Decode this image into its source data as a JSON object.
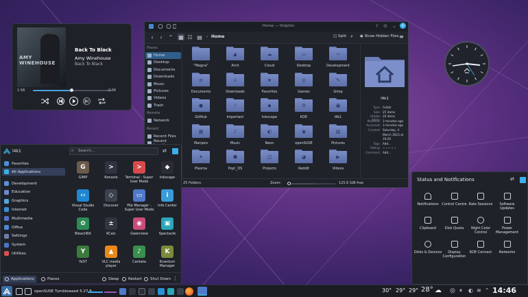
{
  "player": {
    "cover_text": "AMY\nWINEHOUSE",
    "title": "Back To Black",
    "artist": "Amy Winehouse",
    "album": "Back To Black",
    "elapsed": "1:58",
    "remaining": "-2:06",
    "progress_fraction": 0.49
  },
  "dolphin": {
    "title": "Home — Dolphin",
    "breadcrumb": "Home",
    "split_label": "Split",
    "hidden_files_label": "Show Hidden Files",
    "places_header": "Places",
    "places": [
      "Home",
      "Desktop",
      "Documents",
      "Downloads",
      "Music",
      "Pictures",
      "Videos",
      "Trash"
    ],
    "remote_header": "Remote",
    "remote": [
      "Network"
    ],
    "recent_header": "Recent",
    "recent": [
      "Recent Files",
      "Recent Locations"
    ],
    "folders": [
      {
        "name": "\"Magna\"",
        "emblem": ""
      },
      {
        "name": "Arch",
        "emblem": "▲"
      },
      {
        "name": "Cloud",
        "emblem": "☁"
      },
      {
        "name": "Desktop",
        "emblem": "▭"
      },
      {
        "name": "Development",
        "emblem": "‹›"
      },
      {
        "name": "Documents",
        "emblem": "≡"
      },
      {
        "name": "Downloads",
        "emblem": "↓"
      },
      {
        "name": "Favorites",
        "emblem": "★"
      },
      {
        "name": "Games",
        "emblem": "◎"
      },
      {
        "name": "Gimp",
        "emblem": "✎"
      },
      {
        "name": "GitHub",
        "emblem": "●"
      },
      {
        "name": "Important",
        "emblem": "!"
      },
      {
        "name": "Inkscape",
        "emblem": "◆"
      },
      {
        "name": "KDE",
        "emblem": "⚙"
      },
      {
        "name": "l4k1",
        "emblem": "▣"
      },
      {
        "name": "Manjaro",
        "emblem": "▦"
      },
      {
        "name": "Music",
        "emblem": "♪"
      },
      {
        "name": "Neon",
        "emblem": "◐"
      },
      {
        "name": "openSUSE",
        "emblem": "◉"
      },
      {
        "name": "Pictures",
        "emblem": "▨"
      },
      {
        "name": "Plasma",
        "emblem": "✦"
      },
      {
        "name": "Pop!_OS",
        "emblem": "⬢"
      },
      {
        "name": "Projects",
        "emblem": "◫"
      },
      {
        "name": "Reddit",
        "emblem": "◕"
      },
      {
        "name": "Videos",
        "emblem": "▶"
      }
    ],
    "info": {
      "name": "l4k1",
      "rows": [
        {
          "k": "Type:",
          "v": "Folder"
        },
        {
          "k": "Size:",
          "v": "25 items"
        },
        {
          "k": "Hidden items:",
          "v": "20 items"
        },
        {
          "k": "Modified:",
          "v": "3 minutes ago"
        },
        {
          "k": "Accessed:",
          "v": "3 minutes ago"
        },
        {
          "k": "Created:",
          "v": "Saturday, 4"
        },
        {
          "k": "",
          "v": "March 2023 at"
        },
        {
          "k": "",
          "v": "19:26"
        },
        {
          "k": "Tags:",
          "v": "Add..."
        },
        {
          "k": "Rating:",
          "v": ""
        },
        {
          "k": "Comment:",
          "v": "Add..."
        }
      ]
    },
    "status_count": "25 Folders",
    "zoom_label": "Zoom:",
    "free_space": "125.6 GiB free"
  },
  "launcher": {
    "user": "l4k1",
    "search_placeholder": "Search...",
    "categories": [
      {
        "label": "Favorites",
        "color": "#4a90d9"
      },
      {
        "label": "All Applications",
        "color": "#3daee9"
      },
      {
        "label": "Development",
        "color": "#5a8fd8"
      },
      {
        "label": "Education",
        "color": "#6c8ad0"
      },
      {
        "label": "Graphics",
        "color": "#57a4e0"
      },
      {
        "label": "Internet",
        "color": "#3a8ed6"
      },
      {
        "label": "Multimedia",
        "color": "#5272c9"
      },
      {
        "label": "Office",
        "color": "#4f86d3"
      },
      {
        "label": "Settings",
        "color": "#6a7ea8"
      },
      {
        "label": "System",
        "color": "#4b74c4"
      },
      {
        "label": "Utilities",
        "color": "#d94f4f"
      }
    ],
    "apps": [
      {
        "label": "GIMP",
        "color": "#6b5b4a",
        "glyph": "G"
      },
      {
        "label": "Konsole",
        "color": "#2f3440",
        "glyph": ">"
      },
      {
        "label": "Terminal - Super User Mode",
        "color": "#d84a4a",
        "glyph": ">"
      },
      {
        "label": "Inkscape",
        "color": "#2a2d33",
        "glyph": "◆"
      },
      {
        "label": "Visual Studio Code",
        "color": "#1f87d1",
        "glyph": "‹›"
      },
      {
        "label": "Discover",
        "color": "#3b4250",
        "glyph": "◇"
      },
      {
        "label": "File Manager - Super User Mode",
        "color": "#4f79c9",
        "glyph": "▭"
      },
      {
        "label": "Info Center",
        "color": "#3a9bd9",
        "glyph": "i"
      },
      {
        "label": "BleachBit",
        "color": "#2c8a55",
        "glyph": "✿"
      },
      {
        "label": "KCalc",
        "color": "#30353f",
        "glyph": "±"
      },
      {
        "label": "Gwenview",
        "color": "#c94c7a",
        "glyph": "◉"
      },
      {
        "label": "Spectacle",
        "color": "#2aa6b8",
        "glyph": "▣"
      },
      {
        "label": "YaST",
        "color": "#3d7a3d",
        "glyph": "Y"
      },
      {
        "label": "VLC media player",
        "color": "#e8891a",
        "glyph": "▲"
      },
      {
        "label": "Cantata",
        "color": "#3a8f4e",
        "glyph": "♪"
      },
      {
        "label": "Kvantum Manager",
        "color": "#7a8b3a",
        "glyph": "K"
      }
    ],
    "footer": {
      "applications": "Applications",
      "places": "Places",
      "sleep": "Sleep",
      "restart": "Restart",
      "shutdown": "Shut Down"
    }
  },
  "status_panel": {
    "title": "Status and Notifications",
    "items": [
      "Notifications",
      "Control Centre",
      "Rate Sessions",
      "Software Updates",
      "Clipboard",
      "Disk Quota",
      "Night Color Control",
      "Power Management",
      "Disks & Devices",
      "Display Configuration",
      "KDE Connect",
      "Networks"
    ]
  },
  "taskbar": {
    "distro": "openSUSE Tumbleweed 5.27.8",
    "temps": [
      "30°",
      "29°",
      "29°",
      "28°"
    ],
    "clock": "14:46"
  }
}
